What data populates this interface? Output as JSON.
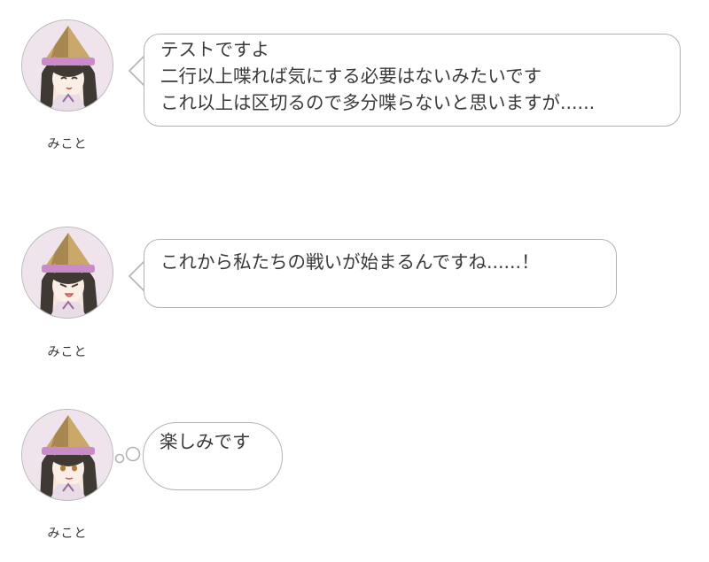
{
  "messages": [
    {
      "speaker": "みこと",
      "avatar": "mikoto-avatar",
      "style": "speech",
      "text": "テストですよ\n二行以上喋れば気にする必要はないみたいです\nこれ以上は区切るので多分喋らないと思いますが......"
    },
    {
      "speaker": "みこと",
      "avatar": "mikoto-avatar",
      "style": "speech",
      "text": "これから私たちの戦いが始まるんですね......！"
    },
    {
      "speaker": "みこと",
      "avatar": "mikoto-avatar",
      "style": "thought",
      "text": "楽しみです"
    }
  ],
  "colors": {
    "bubble_border": "#b3b3b3",
    "text": "#3a3a3a",
    "avatar_bg": "#f2e7ef",
    "hat": "#c9a86a",
    "ribbon": "#c98bc9",
    "hair": "#3e3a33"
  }
}
